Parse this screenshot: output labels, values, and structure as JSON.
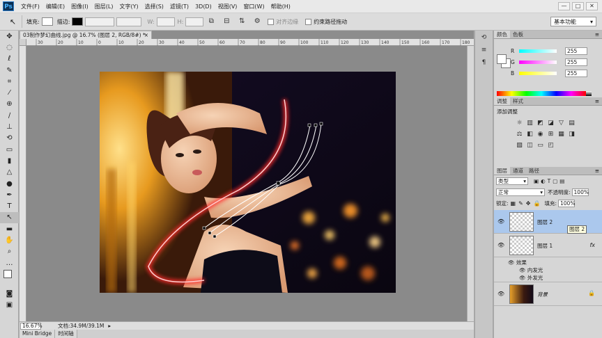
{
  "app": {
    "logo": "Ps",
    "menu": [
      "文件(F)",
      "编辑(E)",
      "图像(I)",
      "图层(L)",
      "文字(Y)",
      "选择(S)",
      "滤镜(T)",
      "3D(D)",
      "视图(V)",
      "窗口(W)",
      "帮助(H)"
    ],
    "window_controls": [
      "—",
      "□",
      "✕"
    ]
  },
  "options": {
    "fill_label": "填充:",
    "stroke_label": "描边:",
    "w_label": "W:",
    "h_label": "H:",
    "align_edges": "对齐边缘",
    "constrain_path": "约束路径拖动",
    "workspace": "基本功能"
  },
  "document": {
    "tab_title": "03制作梦幻曲线.jpg @ 16.7% (图层 2, RGB/8#) *",
    "zoom": "16.67%",
    "doc_info": "文档:34.9M/39.1M",
    "ruler_marks": [
      "30",
      "20",
      "10",
      "0",
      "10",
      "20",
      "30",
      "40",
      "50",
      "60",
      "70",
      "80",
      "90",
      "100",
      "110",
      "120",
      "130",
      "140",
      "150",
      "160",
      "170",
      "180"
    ]
  },
  "bottom_tabs": [
    "Mini Bridge",
    "时间轴"
  ],
  "color_panel": {
    "tabs": [
      "颜色",
      "色板"
    ],
    "channels": [
      {
        "label": "R",
        "value": "255",
        "gradient": "linear-gradient(90deg,#00ffff,#ffffff)"
      },
      {
        "label": "G",
        "value": "255",
        "gradient": "linear-gradient(90deg,#ff00ff,#ffffff)"
      },
      {
        "label": "B",
        "value": "255",
        "gradient": "linear-gradient(90deg,#ffff00,#ffffff)"
      }
    ]
  },
  "adjust_panel": {
    "tabs": [
      "调整",
      "样式"
    ],
    "title": "添加调整"
  },
  "layers_panel": {
    "tabs": [
      "图层",
      "通道",
      "路径"
    ],
    "filter_kind": "类型",
    "blend_mode": "正常",
    "opacity_label": "不透明度:",
    "opacity_value": "100%",
    "lock_label": "锁定:",
    "fill_label": "填充:",
    "fill_value": "100%",
    "layers": [
      {
        "name": "图层 2",
        "tooltip": "图层 2"
      },
      {
        "name": "图层 1",
        "fx": "fx",
        "effects_label": "效果",
        "effects": [
          "内发光",
          "外发光"
        ]
      },
      {
        "name": "背景"
      }
    ]
  },
  "colors": {
    "accent_selection": "#abc8ed",
    "glow": "#ff2a2a"
  }
}
